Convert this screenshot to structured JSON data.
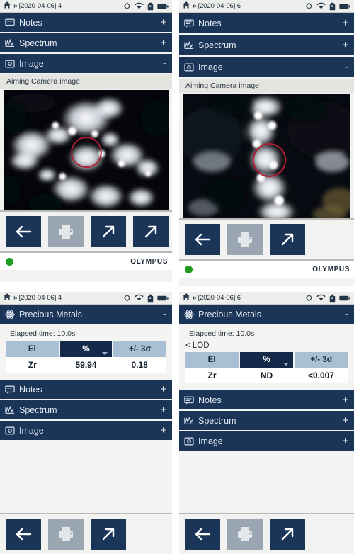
{
  "device": {
    "brand": "OLYMPUS",
    "accent_navy": "#1b3558",
    "header_dark": "#14294a",
    "table_header_blue": "#a9c0d4",
    "led_green": "#1f9c1f",
    "reticle_red": "#b01d32"
  },
  "panels": {
    "top_left": {
      "statusbar": {
        "home_icon": "home-icon",
        "separator": "»",
        "breadcrumb": "[2020-04-06] 4",
        "icons": [
          "compass-icon",
          "wifi-icon",
          "usb-drive-icon",
          "battery-icon"
        ]
      },
      "sections": [
        {
          "icon": "notes-icon",
          "label": "Notes",
          "toggle": "+"
        },
        {
          "icon": "spectrum-icon",
          "label": "Spectrum",
          "toggle": "+"
        },
        {
          "icon": "image-icon",
          "label": "Image",
          "toggle": "-"
        }
      ],
      "image_caption": "Aiming Camera image",
      "buttons": [
        {
          "name": "back-button",
          "icon": "arrow-left-icon",
          "disabled": false
        },
        {
          "name": "print-button",
          "icon": "printer-icon",
          "disabled": true
        },
        {
          "name": "export-button",
          "icon": "arrow-up-right-icon",
          "disabled": false
        },
        {
          "name": "share-button",
          "icon": "arrow-up-right-icon",
          "disabled": false
        }
      ],
      "footer": {
        "status_led": "green",
        "logo": "OLYMPUS"
      }
    },
    "top_right": {
      "statusbar": {
        "home_icon": "home-icon",
        "separator": "»",
        "breadcrumb": "[2020-04-06] 6",
        "icons": [
          "compass-icon",
          "wifi-icon",
          "usb-drive-icon",
          "battery-icon"
        ]
      },
      "sections": [
        {
          "icon": "notes-icon",
          "label": "Notes",
          "toggle": "+"
        },
        {
          "icon": "spectrum-icon",
          "label": "Spectrum",
          "toggle": "+"
        },
        {
          "icon": "image-icon",
          "label": "Image",
          "toggle": "-"
        }
      ],
      "image_caption": "Aiming Camera image",
      "buttons": [
        {
          "name": "back-button",
          "icon": "arrow-left-icon",
          "disabled": false
        },
        {
          "name": "print-button",
          "icon": "printer-icon",
          "disabled": true
        },
        {
          "name": "export-button",
          "icon": "arrow-up-right-icon",
          "disabled": false
        }
      ],
      "footer": {
        "status_led": "green",
        "logo": "OLYMPUS"
      }
    },
    "bottom_left": {
      "statusbar": {
        "home_icon": "home-icon",
        "separator": "»",
        "breadcrumb": "[2020-04-06] 4",
        "icons": [
          "compass-icon",
          "wifi-icon",
          "usb-drive-icon",
          "battery-icon"
        ]
      },
      "result_header": {
        "icon": "atom-icon",
        "label": "Precious Metals",
        "toggle": "-"
      },
      "elapsed": "Elapsed time: 10.0s",
      "lod_note": "",
      "table": {
        "columns": [
          "El",
          "%",
          "+/- 3σ"
        ],
        "selected_column": "%",
        "rows": [
          [
            "Zr",
            "59.94",
            "0.18"
          ]
        ]
      },
      "sections": [
        {
          "icon": "notes-icon",
          "label": "Notes",
          "toggle": "+"
        },
        {
          "icon": "spectrum-icon",
          "label": "Spectrum",
          "toggle": "+"
        },
        {
          "icon": "image-icon",
          "label": "Image",
          "toggle": "+"
        }
      ],
      "buttons": [
        {
          "name": "back-button",
          "icon": "arrow-left-icon",
          "disabled": false
        },
        {
          "name": "print-button",
          "icon": "printer-icon",
          "disabled": true
        },
        {
          "name": "export-button",
          "icon": "arrow-up-right-icon",
          "disabled": false
        }
      ]
    },
    "bottom_right": {
      "statusbar": {
        "home_icon": "home-icon",
        "separator": "»",
        "breadcrumb": "[2020-04-06] 6",
        "icons": [
          "compass-icon",
          "wifi-icon",
          "usb-drive-icon",
          "battery-icon"
        ]
      },
      "result_header": {
        "icon": "atom-icon",
        "label": "Precious Metals",
        "toggle": "-"
      },
      "elapsed": "Elapsed time: 10.0s",
      "lod_note": "< LOD",
      "table": {
        "columns": [
          "El",
          "%",
          "+/- 3σ"
        ],
        "selected_column": "%",
        "rows": [
          [
            "Zr",
            "ND",
            "<0.007"
          ]
        ]
      },
      "sections": [
        {
          "icon": "notes-icon",
          "label": "Notes",
          "toggle": "+"
        },
        {
          "icon": "spectrum-icon",
          "label": "Spectrum",
          "toggle": "+"
        },
        {
          "icon": "image-icon",
          "label": "Image",
          "toggle": "+"
        }
      ],
      "buttons": [
        {
          "name": "back-button",
          "icon": "arrow-left-icon",
          "disabled": false
        },
        {
          "name": "print-button",
          "icon": "printer-icon",
          "disabled": true
        },
        {
          "name": "export-button",
          "icon": "arrow-up-right-icon",
          "disabled": false
        }
      ]
    }
  }
}
